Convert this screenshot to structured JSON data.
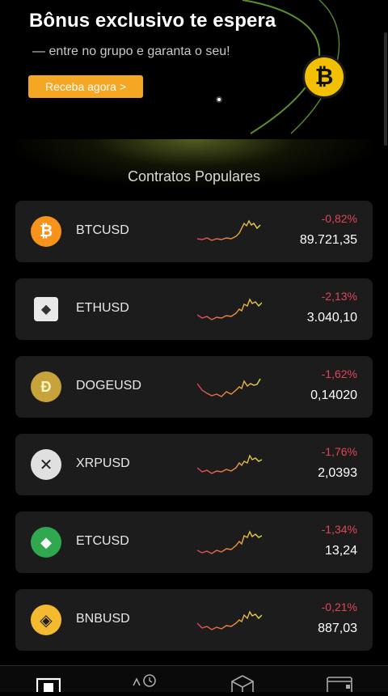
{
  "banner": {
    "title": "Bônus exclusivo te espera",
    "subtitle": "— entre no grupo e garanta o seu!",
    "cta_label": "Receba agora  >",
    "badge_icon": "bitcoin-icon"
  },
  "section": {
    "title": "Contratos Populares"
  },
  "colors": {
    "accent": "#f5a623",
    "negative": "#e0445c",
    "card": "#1c1c1c"
  },
  "contracts": [
    {
      "symbol": "BTCUSD",
      "change": "-0,82%",
      "price": "89.721,35",
      "icon": "bitcoin-icon"
    },
    {
      "symbol": "ETHUSD",
      "change": "-2,13%",
      "price": "3.040,10",
      "icon": "ethereum-icon"
    },
    {
      "symbol": "DOGEUSD",
      "change": "-1,62%",
      "price": "0,14020",
      "icon": "dogecoin-icon"
    },
    {
      "symbol": "XRPUSD",
      "change": "-1,76%",
      "price": "2,0393",
      "icon": "xrp-icon"
    },
    {
      "symbol": "ETCUSD",
      "change": "-1,34%",
      "price": "13,24",
      "icon": "ethereum-classic-icon"
    },
    {
      "symbol": "BNBUSD",
      "change": "-0,21%",
      "price": "887,03",
      "icon": "bnb-icon"
    }
  ],
  "bottom_nav": [
    {
      "icon": "home-square-icon"
    },
    {
      "icon": "history-clock-icon"
    },
    {
      "icon": "box-icon"
    },
    {
      "icon": "wallet-icon"
    }
  ]
}
